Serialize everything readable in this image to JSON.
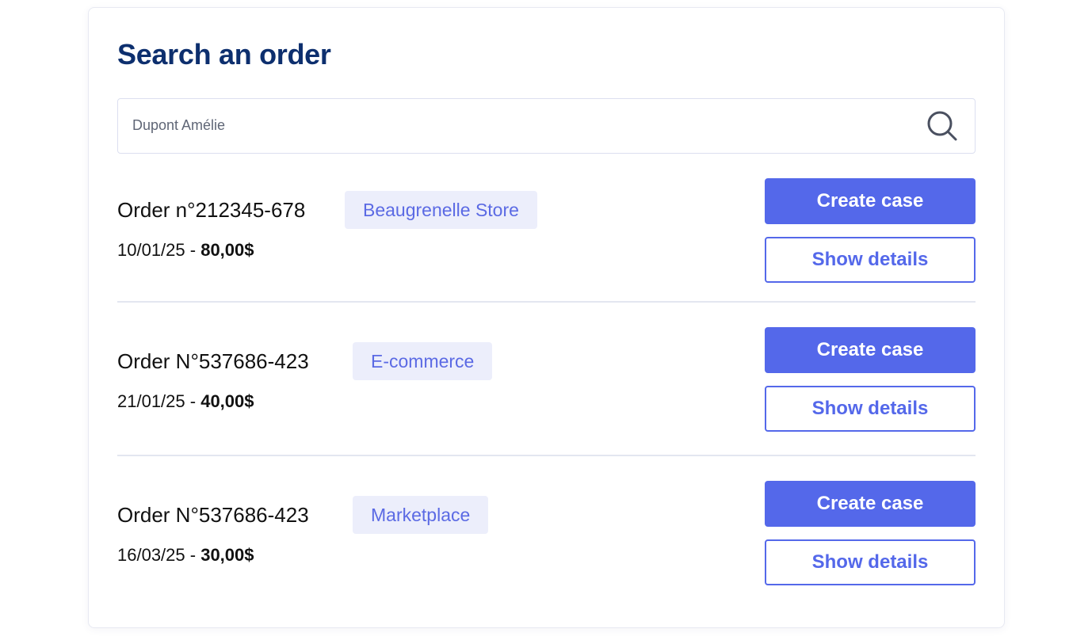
{
  "title": "Search an order",
  "search": {
    "value": "",
    "placeholder": "Dupont Amélie",
    "icon": "search-icon"
  },
  "orders": [
    {
      "number": "Order n°212345-678",
      "channel": "Beaugrenelle Store",
      "date": "10/01/25",
      "separator": " - ",
      "amount": "80,00$",
      "primary_action": "Create case",
      "secondary_action": "Show details"
    },
    {
      "number": "Order N°537686-423",
      "channel": "E-commerce",
      "date": "21/01/25",
      "separator": " - ",
      "amount": "40,00$",
      "primary_action": "Create case",
      "secondary_action": "Show details"
    },
    {
      "number": "Order N°537686-423",
      "channel": "Marketplace",
      "date": "16/03/25",
      "separator": " - ",
      "amount": "30,00$",
      "primary_action": "Create case",
      "secondary_action": "Show details"
    }
  ],
  "colors": {
    "title": "#0d2f6e",
    "accent": "#5468ea",
    "badge_bg": "#eceefb",
    "badge_text": "#5b6ae4",
    "divider": "#e3e6f0"
  }
}
